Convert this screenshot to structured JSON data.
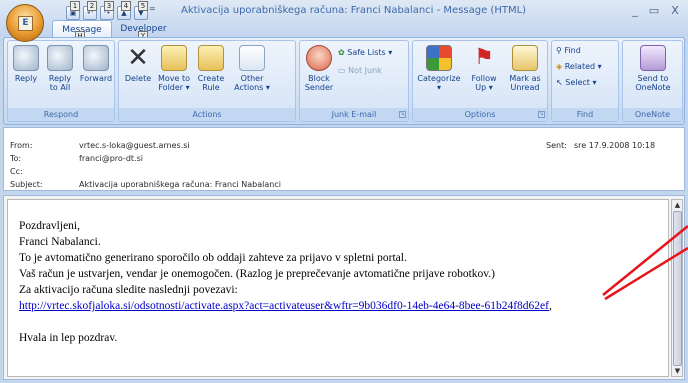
{
  "window": {
    "title": "Aktivacija uporabniškega računa: Franci Nabalanci  -  Message (HTML)",
    "controls": [
      "_",
      "▭",
      "X"
    ]
  },
  "office_button": {
    "glyph": "E"
  },
  "qat": {
    "keytips": [
      "1",
      "2",
      "3",
      "4",
      "5"
    ],
    "more": "="
  },
  "tabs": [
    {
      "label": "Message",
      "keytip": "H"
    },
    {
      "label": "Developer",
      "keytip": "Y"
    }
  ],
  "ribbon": {
    "groups": {
      "respond": "Respond",
      "actions": "Actions",
      "junk": "Junk E-mail",
      "options": "Options",
      "find": "Find",
      "onenote": "OneNote"
    },
    "buttons": {
      "reply": "Reply",
      "reply_all_1": "Reply",
      "reply_all_2": "to All",
      "forward": "Forward",
      "delete": "Delete",
      "move_1": "Move to",
      "move_2": "Folder ▾",
      "create_1": "Create",
      "create_2": "Rule",
      "other_1": "Other",
      "other_2": "Actions ▾",
      "block_1": "Block",
      "block_2": "Sender",
      "safe_lists": "Safe Lists ▾",
      "not_junk": "Not Junk",
      "categorize": "Categorize",
      "categorize_arrow": "▾",
      "follow_1": "Follow",
      "follow_2": "Up ▾",
      "mark_1": "Mark as",
      "mark_2": "Unread",
      "find": "Find",
      "related": "Related ▾",
      "select": "Select ▾",
      "onenote_1": "Send to",
      "onenote_2": "OneNote"
    }
  },
  "message_header": {
    "from_label": "From:",
    "from": "vrtec.s-loka@guest.arnes.si",
    "to_label": "To:",
    "to": "franci@pro-dt.si",
    "cc_label": "Cc:",
    "cc": "",
    "subject_label": "Subject:",
    "subject": "Aktivacija uporabniškega računa: Franci Nabalanci",
    "sent_label": "Sent:",
    "sent": "sre 17.9.2008 10:18"
  },
  "message_body": {
    "lines": [
      "Pozdravljeni,",
      "Franci Nabalanci.",
      "To je avtomatično generirano sporočilo ob oddaji zahteve za prijavo v spletni portal.",
      "Vaš račun je ustvarjen, vendar je onemogočen. (Razlog je preprečevanje avtomatične prijave robotkov.)",
      "Za aktivacijo računa sledite naslednji povezavi:"
    ],
    "link": "http://vrtec.skofjaloka.si/odsotnosti/activate.aspx?act=activateuser&wftr=9b036df0-14eb-4e64-8bee-61b24f8d62ef",
    "link_suffix": ",",
    "closing": "Hvala in lep pozdrav."
  },
  "colors": {
    "annotation_arrow": "#e8141b",
    "link": "#0000cc",
    "ribbon_text": "#15428b"
  }
}
